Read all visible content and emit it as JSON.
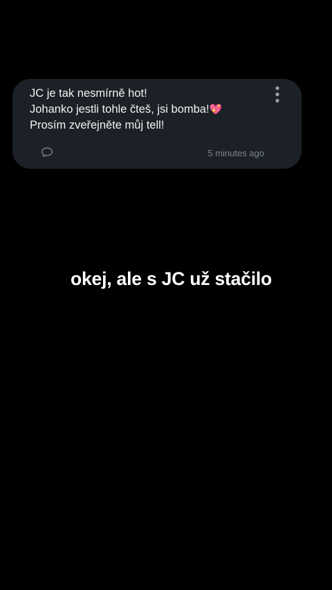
{
  "post": {
    "lines": [
      "JC je tak nesmírně hot!",
      "Johanko jestli tohle čteš, jsi bomba!",
      "Prosím zveřejněte můj tell!"
    ],
    "emoji": "💖",
    "timestamp": "5 minutes ago",
    "icons": {
      "menu": "more-vertical-icon",
      "comment": "comment-bubble-icon"
    }
  },
  "overlay": {
    "caption": "okej, ale s JC už stačilo"
  },
  "colors": {
    "background": "#000000",
    "card": "#1c2127",
    "text": "#f2f2f2",
    "muted": "#7d848b"
  }
}
